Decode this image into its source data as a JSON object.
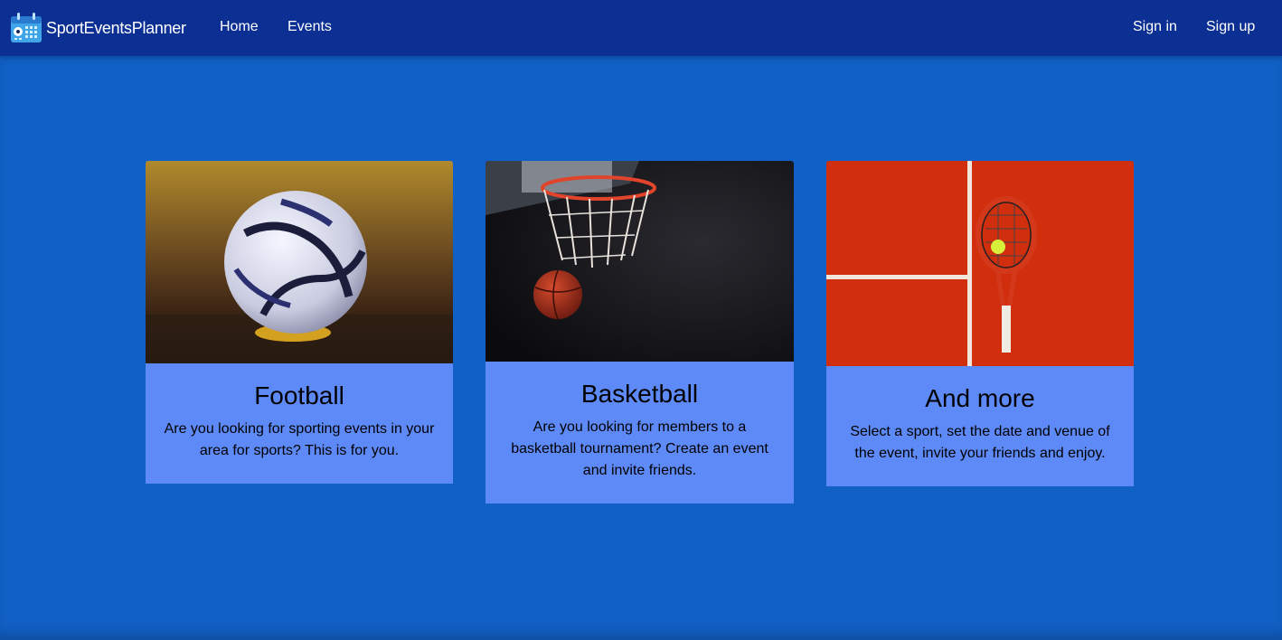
{
  "navbar": {
    "brand": "SportEventsPlanner",
    "links": [
      {
        "label": "Home"
      },
      {
        "label": "Events"
      }
    ],
    "sign_in": "Sign in",
    "sign_up": "Sign up"
  },
  "cards": [
    {
      "title": "Football",
      "text": "Are you looking for sporting events in your area for sports? This is for you.",
      "image": "football-photo"
    },
    {
      "title": "Basketball",
      "text": "Are you looking for members to a basketball tournament? Create an event and invite friends.",
      "image": "basketball-photo"
    },
    {
      "title": "And more",
      "text": "Select a sport, set the date and venue of the event, invite your friends and enjoy.",
      "image": "tennis-photo"
    }
  ],
  "colors": {
    "navbar": "#0c2f94",
    "background": "#1160c6",
    "card": "#5e8af8"
  }
}
